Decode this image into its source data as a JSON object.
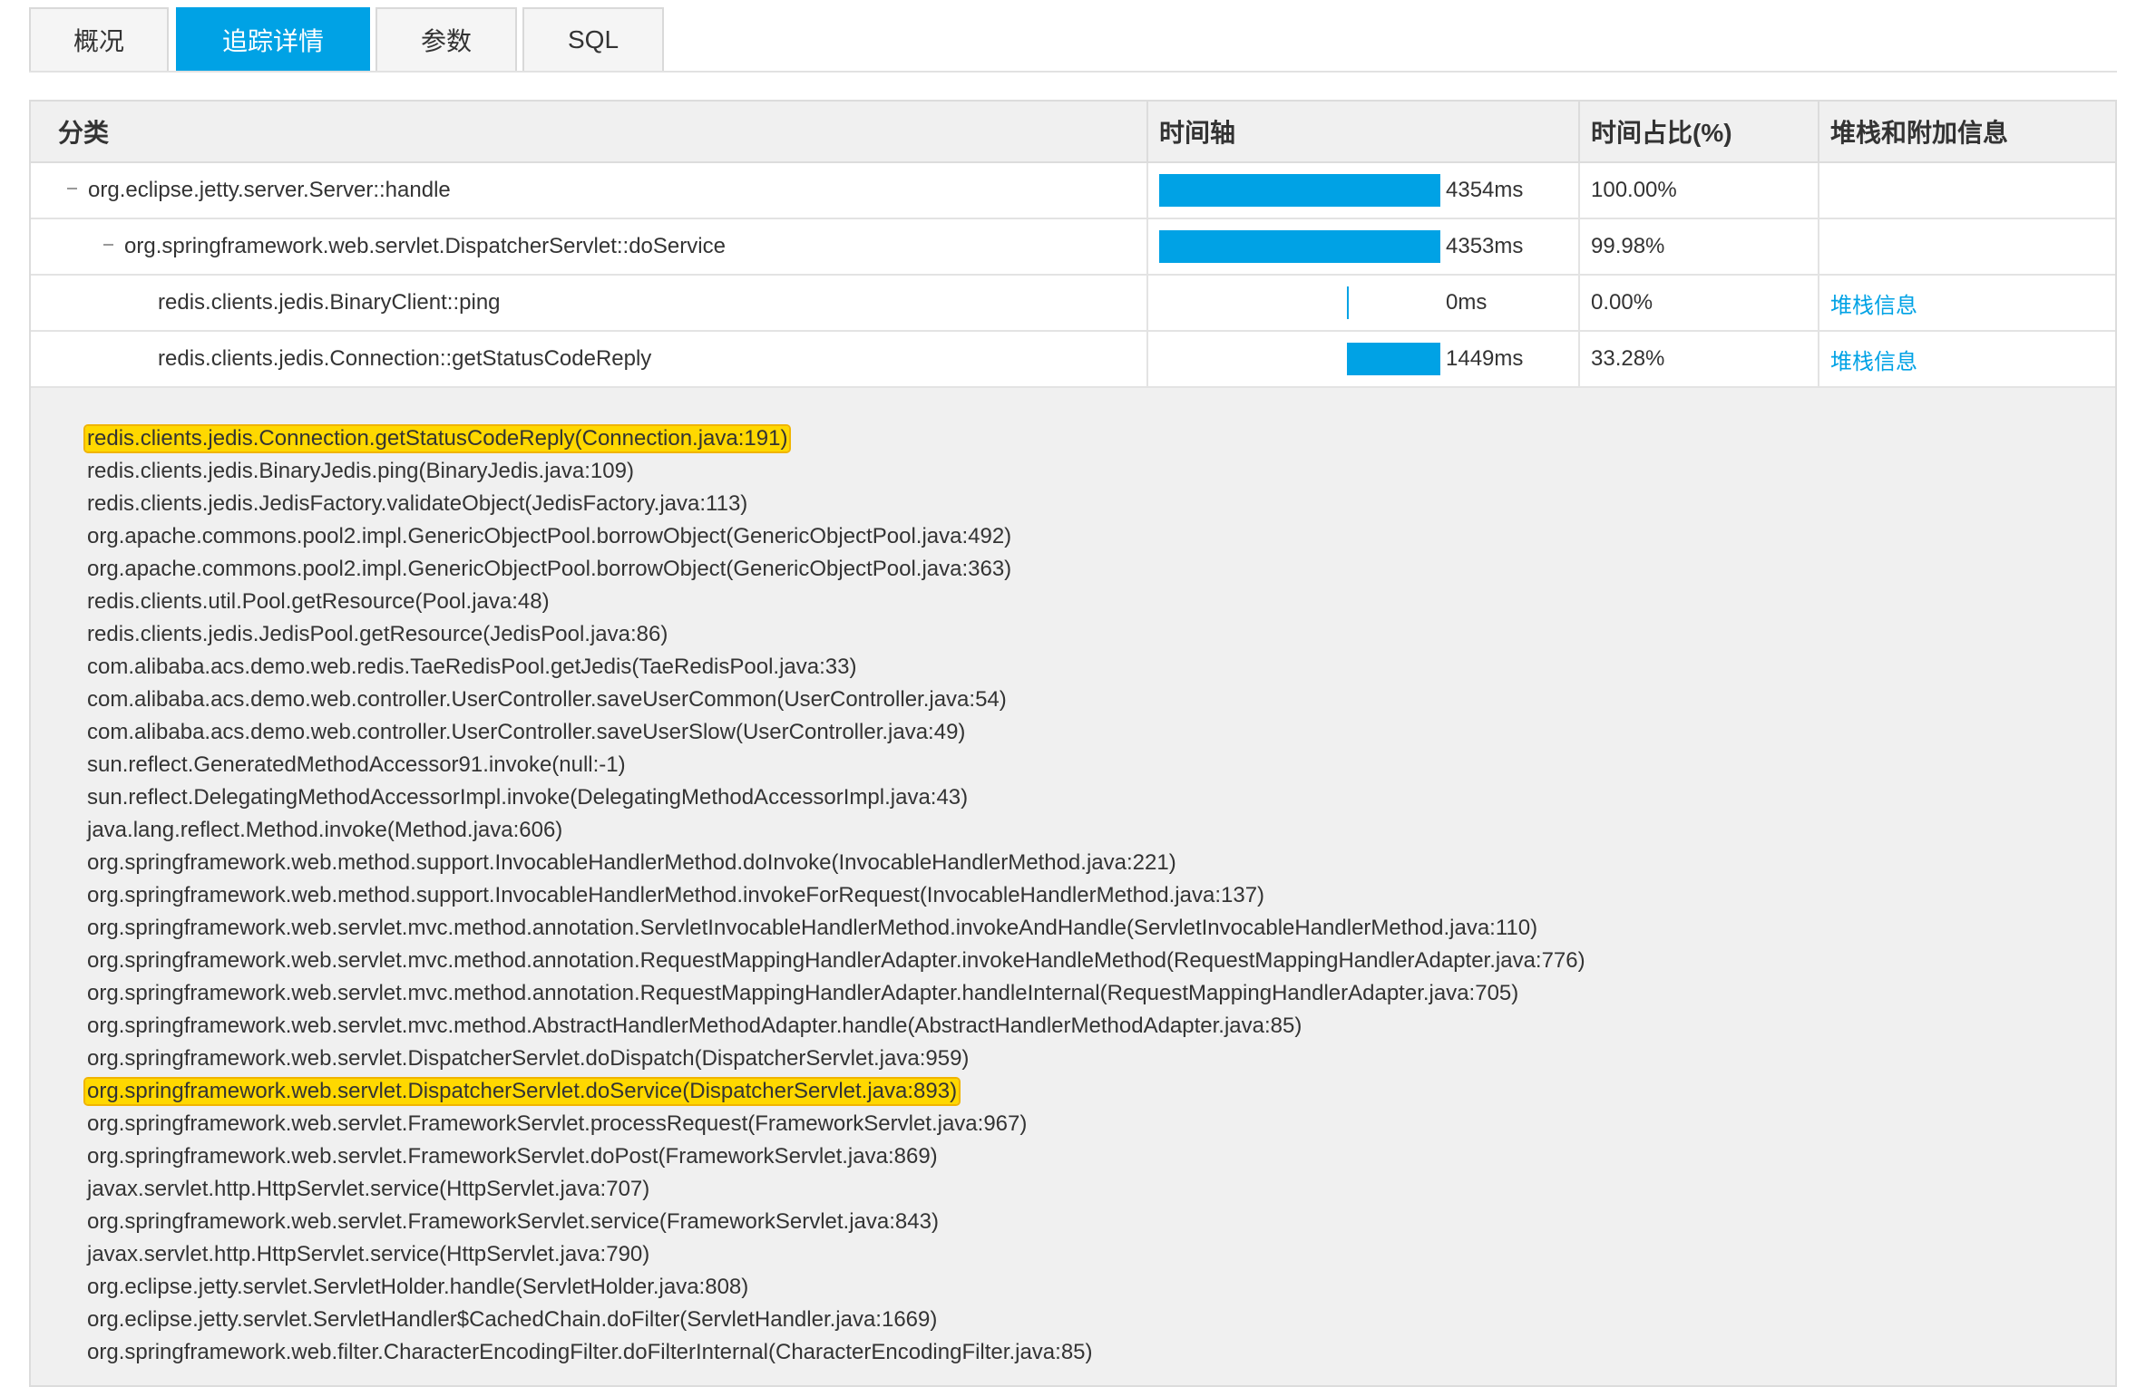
{
  "tabs": [
    {
      "label": "概况",
      "active": false
    },
    {
      "label": "追踪详情",
      "active": true
    },
    {
      "label": "参数",
      "active": false
    },
    {
      "label": "SQL",
      "active": false
    }
  ],
  "table": {
    "headers": {
      "category": "分类",
      "timeline": "时间轴",
      "ratio": "时间占比(%)",
      "stack": "堆栈和附加信息"
    },
    "rows": [
      {
        "name": "org.eclipse.jetty.server.Server::handle",
        "duration": "4354ms",
        "ratio": "100.00%",
        "extra": "",
        "collapsible": true,
        "start_fraction": 0.0,
        "length_fraction": 1.0
      },
      {
        "name": "org.springframework.web.servlet.DispatcherServlet::doService",
        "duration": "4353ms",
        "ratio": "99.98%",
        "extra": "",
        "collapsible": true,
        "start_fraction": 0.0,
        "length_fraction": 0.9998
      },
      {
        "name": "redis.clients.jedis.BinaryClient::ping",
        "duration": "0ms",
        "ratio": "0.00%",
        "extra": "堆栈信息",
        "collapsible": false,
        "start_fraction": 0.667,
        "length_fraction": 0.0
      },
      {
        "name": "redis.clients.jedis.Connection::getStatusCodeReply",
        "duration": "1449ms",
        "ratio": "33.28%",
        "extra": "堆栈信息",
        "collapsible": false,
        "start_fraction": 0.667,
        "length_fraction": 0.3328
      }
    ]
  },
  "stack_trace": [
    {
      "text": "redis.clients.jedis.Connection.getStatusCodeReply(Connection.java:191)",
      "highlight": true
    },
    {
      "text": "redis.clients.jedis.BinaryJedis.ping(BinaryJedis.java:109)",
      "highlight": false
    },
    {
      "text": "redis.clients.jedis.JedisFactory.validateObject(JedisFactory.java:113)",
      "highlight": false
    },
    {
      "text": "org.apache.commons.pool2.impl.GenericObjectPool.borrowObject(GenericObjectPool.java:492)",
      "highlight": false
    },
    {
      "text": "org.apache.commons.pool2.impl.GenericObjectPool.borrowObject(GenericObjectPool.java:363)",
      "highlight": false
    },
    {
      "text": "redis.clients.util.Pool.getResource(Pool.java:48)",
      "highlight": false
    },
    {
      "text": "redis.clients.jedis.JedisPool.getResource(JedisPool.java:86)",
      "highlight": false
    },
    {
      "text": "com.alibaba.acs.demo.web.redis.TaeRedisPool.getJedis(TaeRedisPool.java:33)",
      "highlight": false
    },
    {
      "text": "com.alibaba.acs.demo.web.controller.UserController.saveUserCommon(UserController.java:54)",
      "highlight": false
    },
    {
      "text": "com.alibaba.acs.demo.web.controller.UserController.saveUserSlow(UserController.java:49)",
      "highlight": false
    },
    {
      "text": "sun.reflect.GeneratedMethodAccessor91.invoke(null:-1)",
      "highlight": false
    },
    {
      "text": "sun.reflect.DelegatingMethodAccessorImpl.invoke(DelegatingMethodAccessorImpl.java:43)",
      "highlight": false
    },
    {
      "text": "java.lang.reflect.Method.invoke(Method.java:606)",
      "highlight": false
    },
    {
      "text": "org.springframework.web.method.support.InvocableHandlerMethod.doInvoke(InvocableHandlerMethod.java:221)",
      "highlight": false
    },
    {
      "text": "org.springframework.web.method.support.InvocableHandlerMethod.invokeForRequest(InvocableHandlerMethod.java:137)",
      "highlight": false
    },
    {
      "text": "org.springframework.web.servlet.mvc.method.annotation.ServletInvocableHandlerMethod.invokeAndHandle(ServletInvocableHandlerMethod.java:110)",
      "highlight": false
    },
    {
      "text": "org.springframework.web.servlet.mvc.method.annotation.RequestMappingHandlerAdapter.invokeHandleMethod(RequestMappingHandlerAdapter.java:776)",
      "highlight": false
    },
    {
      "text": "org.springframework.web.servlet.mvc.method.annotation.RequestMappingHandlerAdapter.handleInternal(RequestMappingHandlerAdapter.java:705)",
      "highlight": false
    },
    {
      "text": "org.springframework.web.servlet.mvc.method.AbstractHandlerMethodAdapter.handle(AbstractHandlerMethodAdapter.java:85)",
      "highlight": false
    },
    {
      "text": "org.springframework.web.servlet.DispatcherServlet.doDispatch(DispatcherServlet.java:959)",
      "highlight": false
    },
    {
      "text": "org.springframework.web.servlet.DispatcherServlet.doService(DispatcherServlet.java:893)",
      "highlight": true
    },
    {
      "text": "org.springframework.web.servlet.FrameworkServlet.processRequest(FrameworkServlet.java:967)",
      "highlight": false
    },
    {
      "text": "org.springframework.web.servlet.FrameworkServlet.doPost(FrameworkServlet.java:869)",
      "highlight": false
    },
    {
      "text": "javax.servlet.http.HttpServlet.service(HttpServlet.java:707)",
      "highlight": false
    },
    {
      "text": "org.springframework.web.servlet.FrameworkServlet.service(FrameworkServlet.java:843)",
      "highlight": false
    },
    {
      "text": "javax.servlet.http.HttpServlet.service(HttpServlet.java:790)",
      "highlight": false
    },
    {
      "text": "org.eclipse.jetty.servlet.ServletHolder.handle(ServletHolder.java:808)",
      "highlight": false
    },
    {
      "text": "org.eclipse.jetty.servlet.ServletHandler$CachedChain.doFilter(ServletHandler.java:1669)",
      "highlight": false
    },
    {
      "text": "org.springframework.web.filter.CharacterEncodingFilter.doFilterInternal(CharacterEncodingFilter.java:85)",
      "highlight": false
    }
  ],
  "colors": {
    "accent": "#00a2e5",
    "highlight": "#ffd800"
  }
}
